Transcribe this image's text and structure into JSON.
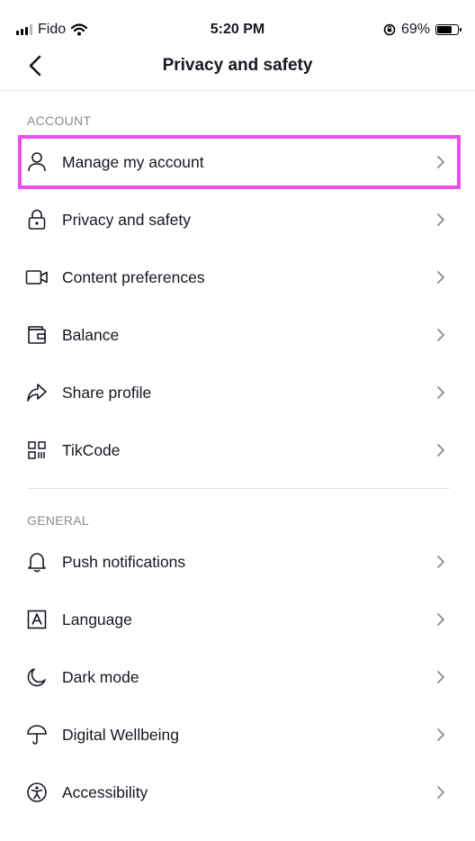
{
  "status_bar": {
    "carrier": "Fido",
    "time": "5:20 PM",
    "battery": "69%",
    "battery_level": 0.69
  },
  "nav": {
    "title": "Privacy and safety",
    "back_icon": "chevron-left-icon"
  },
  "highlight_color": "#ee4ded",
  "account_section": {
    "header": "ACCOUNT",
    "items": [
      {
        "label": "Manage my account",
        "icon": "person-icon"
      },
      {
        "label": "Privacy and safety",
        "icon": "lock-icon"
      },
      {
        "label": "Content preferences",
        "icon": "video-camera-icon"
      },
      {
        "label": "Balance",
        "icon": "wallet-icon"
      },
      {
        "label": "Share profile",
        "icon": "share-arrow-icon"
      },
      {
        "label": "TikCode",
        "icon": "qr-code-icon"
      }
    ]
  },
  "general_section": {
    "header": "GENERAL",
    "items": [
      {
        "label": "Push notifications",
        "icon": "bell-icon"
      },
      {
        "label": "Language",
        "icon": "language-icon"
      },
      {
        "label": "Dark mode",
        "icon": "moon-icon"
      },
      {
        "label": "Digital Wellbeing",
        "icon": "umbrella-icon"
      },
      {
        "label": "Accessibility",
        "icon": "accessibility-icon"
      }
    ]
  }
}
